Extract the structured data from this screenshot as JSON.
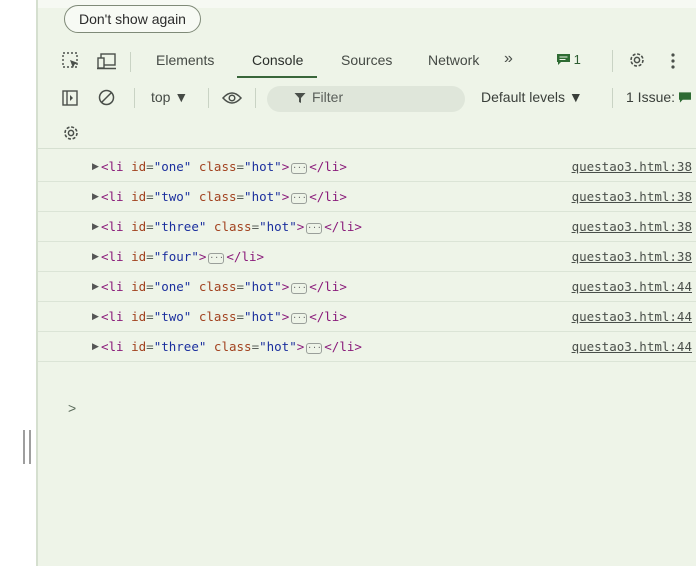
{
  "banner": {
    "dont_show_label": "Don't show again"
  },
  "tabs": {
    "elements": "Elements",
    "console": "Console",
    "sources": "Sources",
    "network": "Network",
    "more": "»",
    "issues_badge_count": "1"
  },
  "toolbar": {
    "context": "top ▼",
    "filter_placeholder": "Filter",
    "levels": "Default levels ▼",
    "issues": "1 Issue:"
  },
  "console_rows": [
    {
      "id": "one",
      "class": "hot",
      "source": "questao3.html:38"
    },
    {
      "id": "two",
      "class": "hot",
      "source": "questao3.html:38"
    },
    {
      "id": "three",
      "class": "hot",
      "source": "questao3.html:38"
    },
    {
      "id": "four",
      "class": null,
      "source": "questao3.html:38"
    },
    {
      "id": "one",
      "class": "hot",
      "source": "questao3.html:44"
    },
    {
      "id": "two",
      "class": "hot",
      "source": "questao3.html:44"
    },
    {
      "id": "three",
      "class": "hot",
      "source": "questao3.html:44"
    }
  ],
  "prompt_symbol": ">",
  "colors": {
    "panel_bg": "#eef4e8",
    "tag": "#8a1b7a",
    "attr_name": "#a2421f",
    "attr_value": "#1b2f9e",
    "accent": "#39663a"
  }
}
